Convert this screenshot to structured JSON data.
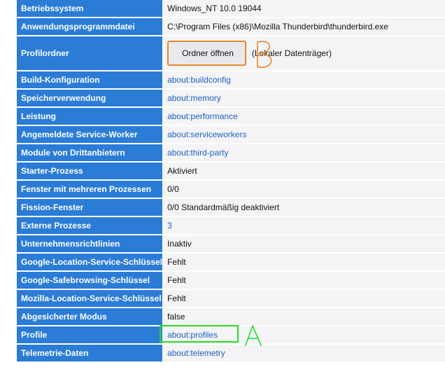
{
  "rows": [
    {
      "key": "Betriebssystem",
      "value": "Windows_NT 10.0 19044",
      "link": false
    },
    {
      "key": "Anwendungsprogrammdatei",
      "value": "C:\\Program Files (x86)\\Mozilla Thunderbird\\thunderbird.exe",
      "link": false
    },
    {
      "key": "Profilordner",
      "button_label": "Ordner öffnen",
      "suffix": "(Lokaler Datenträger)"
    },
    {
      "key": "Build-Konfiguration",
      "value": "about:buildconfig",
      "link": true
    },
    {
      "key": "Speicherverwendung",
      "value": "about:memory",
      "link": true
    },
    {
      "key": "Leistung",
      "value": "about:performance",
      "link": true
    },
    {
      "key": "Angemeldete Service-Worker",
      "value": "about:serviceworkers",
      "link": true
    },
    {
      "key": "Module von Drittanbietern",
      "value": "about:third-party",
      "link": true
    },
    {
      "key": "Starter-Prozess",
      "value": "Aktiviert",
      "link": false
    },
    {
      "key": "Fenster mit mehreren Prozessen",
      "value": "0/0",
      "link": false
    },
    {
      "key": "Fission-Fenster",
      "value": "0/0 Standardmäßig deaktiviert",
      "link": false
    },
    {
      "key": "Externe Prozesse",
      "value": "3",
      "link": true
    },
    {
      "key": "Unternehmensrichtlinien",
      "value": "Inaktiv",
      "link": false
    },
    {
      "key": "Google-Location-Service-Schlüssel",
      "value": "Fehlt",
      "link": false
    },
    {
      "key": "Google-Safebrowsing-Schlüssel",
      "value": "Fehlt",
      "link": false
    },
    {
      "key": "Mozilla-Location-Service-Schlüssel",
      "value": "Fehlt",
      "link": false
    },
    {
      "key": "Abgesicherter Modus",
      "value": "false",
      "link": false
    },
    {
      "key": "Profile",
      "value": "about:profiles",
      "link": true
    },
    {
      "key": "Telemetrie-Daten",
      "value": "about:telemetry",
      "link": true
    }
  ],
  "annotations": {
    "marker_a": "A",
    "marker_b": "B"
  },
  "colors": {
    "key_bg": "#2b7cd6",
    "value_bg": "#f4f4f6",
    "link": "#1f5fc4",
    "annotation_orange": "#e58a2a",
    "annotation_green": "#22e022"
  }
}
